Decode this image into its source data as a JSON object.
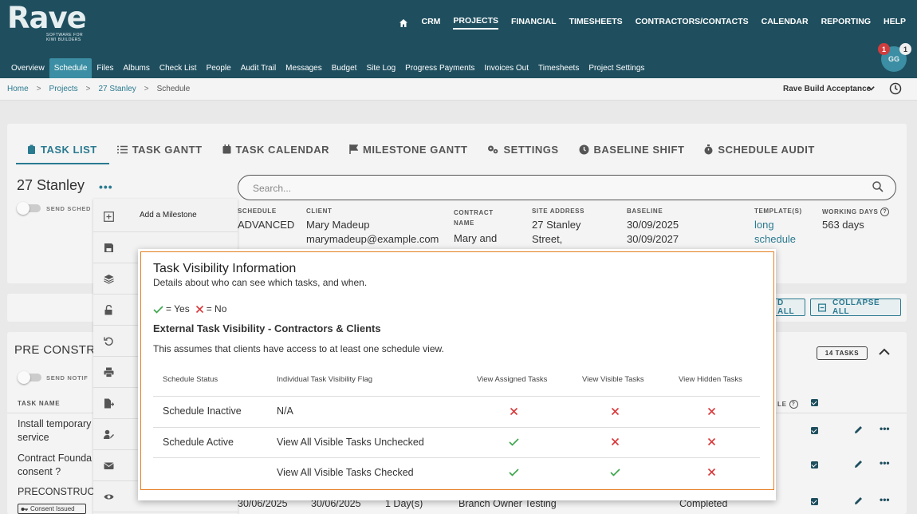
{
  "app": {
    "logo_text": "Rave",
    "logo_sub": "SOFTWARE FOR KIWI BUILDERS"
  },
  "mainnav": {
    "items": [
      "CRM",
      "PROJECTS",
      "FINANCIAL",
      "TIMESHEETS",
      "CONTRACTORS/CONTACTS",
      "CALENDAR",
      "REPORTING",
      "HELP"
    ],
    "active": "PROJECTS"
  },
  "subnav": {
    "items": [
      "Overview",
      "Schedule",
      "Files",
      "Albums",
      "Check List",
      "People",
      "Audit Trail",
      "Messages",
      "Budget",
      "Site Log",
      "Progress Payments",
      "Invoices Out",
      "Timesheets",
      "Project Settings"
    ],
    "active": "Schedule"
  },
  "user": {
    "initials": "GG",
    "badge_red": "1",
    "badge_grey": "1"
  },
  "breadcrumb": {
    "home": "Home",
    "projects": "Projects",
    "project": "27 Stanley",
    "current": "Schedule",
    "sep": ">"
  },
  "rave_build": "Rave Build Acceptance",
  "tabs": [
    "TASK LIST",
    "TASK GANTT",
    "TASK CALENDAR",
    "MILESTONE GANTT",
    "SETTINGS",
    "BASELINE SHIFT",
    "SCHEDULE AUDIT"
  ],
  "project": {
    "title": "27 Stanley",
    "send_sched_label": "SEND SCHED",
    "search_placeholder": "Search...",
    "schedule_h": "SCHEDULE",
    "schedule_v": "ADVANCED",
    "client_h": "CLIENT",
    "client_name": "Mary Madeup",
    "client_email": "marymadeup@example.com",
    "contract_h": "CONTRACT NAME",
    "contract_v": "Mary and",
    "site_h": "SITE ADDRESS",
    "site_v1": "27 Stanley",
    "site_v2": "Street,",
    "baseline_h": "BASELINE",
    "baseline_v1": "30/09/2025",
    "baseline_v2": "30/09/2027",
    "template_h": "TEMPLATE(S)",
    "template_v1": "long",
    "template_v2": "schedule",
    "working_h": "WORKING DAYS",
    "working_v": "563 days"
  },
  "menu": {
    "items": [
      "Add a Milestone"
    ]
  },
  "buttons": {
    "expand_all": "D ALL",
    "collapse_all": "COLLAPSE ALL"
  },
  "section": {
    "title": "PRE CONSTR",
    "task_count": "14 TASKS",
    "send_notif": "SEND NOTIF",
    "col_task_name": "TASK NAME",
    "col_le": "LE",
    "rows": [
      {
        "name1": "Install temporary",
        "name2": "service"
      },
      {
        "name1": "Contract Founda",
        "name2": "consent ?"
      },
      {
        "name1": "PRECONSTRUCT"
      }
    ],
    "consent_chip": "Consent Issued",
    "last_row": {
      "start": "30/06/2025",
      "end": "30/06/2025",
      "duration": "1 Day(s)",
      "owner": "Branch Owner Testing",
      "status": "Completed"
    }
  },
  "modal": {
    "title": "Task Visibility Information",
    "subtitle": "Details about who can see which tasks, and when.",
    "legend_yes": "= Yes",
    "legend_no": "= No",
    "heading": "External Task Visibility - Contractors & Clients",
    "note": "This assumes that clients have access to at least one schedule view.",
    "columns": [
      "Schedule Status",
      "Individual Task Visibility Flag",
      "View Assigned Tasks",
      "View Visible Tasks",
      "View Hidden Tasks"
    ],
    "rows": [
      {
        "status": "Schedule Inactive",
        "flag": "N/A",
        "assigned": "no",
        "visible": "no",
        "hidden": "no"
      },
      {
        "status": "Schedule Active",
        "flag": "View All Visible Tasks Unchecked",
        "assigned": "yes",
        "visible": "no",
        "hidden": "no"
      },
      {
        "status": "",
        "flag": "View All Visible Tasks Checked",
        "assigned": "yes",
        "visible": "yes",
        "hidden": "no"
      }
    ]
  },
  "colors": {
    "header": "#1f4f5f",
    "accent": "#2a7a90",
    "yes": "#3aa54a",
    "no": "#d9383a",
    "highlight": "#e67e22"
  }
}
